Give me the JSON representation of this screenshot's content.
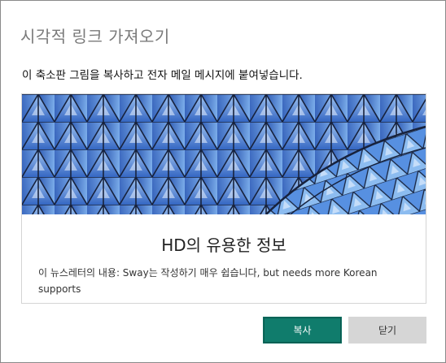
{
  "dialog": {
    "title": "시각적 링크 가져오기",
    "instruction": "이 축소판 그림을 복사하고 전자 메일 메시지에 붙여넣습니다."
  },
  "card": {
    "image_icon": "geometric-glass-roof-image",
    "title": "HD의 유용한 정보",
    "description": "이 뉴스레터의 내용: Sway는 작성하기 매우 쉽습니다, but needs more Korean supports"
  },
  "buttons": {
    "copy_label": "복사",
    "close_label": "닫기"
  },
  "colors": {
    "accent": "#107c6c",
    "secondary_button": "#d6d6d6",
    "hero_blue": "#3f7fd6"
  }
}
